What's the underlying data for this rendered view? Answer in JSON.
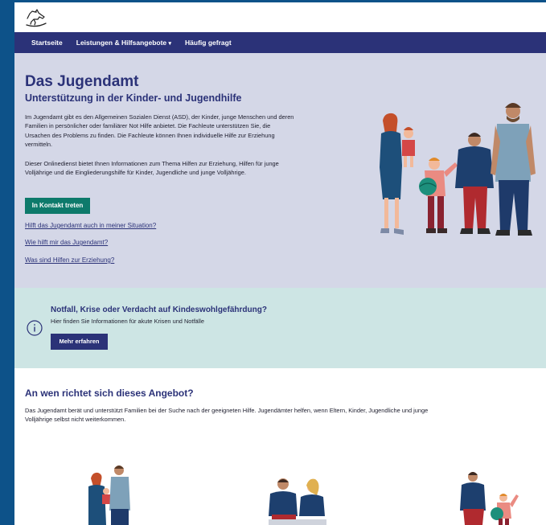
{
  "nav": {
    "items": [
      "Startseite",
      "Leistungen & Hilfsangebote",
      "Häufig gefragt"
    ]
  },
  "hero": {
    "title": "Das Jugendamt",
    "subtitle": "Unterstützung in der Kinder- und Jugendhilfe",
    "paragraph1": "Im Jugendamt gibt es den Allgemeinen Sozialen Dienst (ASD), der Kinder, junge Menschen und deren Familien in persönlicher oder familiärer Not Hilfe anbietet. Die Fachleute unterstützen Sie, die Ursachen des Problems zu finden. Die Fachleute können Ihnen individuelle Hilfe zur Erziehung vermitteln.",
    "paragraph2": "Dieser Onlinedienst bietet Ihnen Informationen zum Thema Hilfen zur Erziehung, Hilfen für junge Volljährige und die Eingliederungshilfe für Kinder, Jugendliche und junge Volljährige.",
    "contact_button": "In Kontakt treten",
    "links": [
      "Hilft das Jugendamt auch in meiner Situation?",
      "Wie hilft mir das Jugendamt?",
      "Was sind Hilfen zur Erziehung?"
    ]
  },
  "alert": {
    "title": "Notfall, Krise oder Verdacht auf Kindeswohlgefährdung?",
    "text": "Hier finden Sie Informationen für akute Krisen und Notfälle",
    "button": "Mehr erfahren"
  },
  "section": {
    "title": "An wen richtet sich dieses Angebot?",
    "text": "Das Jugendamt berät und unterstützt Familien bei der Suche nach der geeigneten Hilfe. Jugendämter helfen, wenn Eltern, Kinder, Jugendliche und junge Volljährige selbst nicht weiterkommen."
  },
  "icons": [
    "rocking-horse-logo",
    "chevron-down-icon",
    "info-icon"
  ],
  "colors": {
    "brand_navy": "#2b3278",
    "frame_blue": "#0d5289",
    "hero_bg": "#d4d7e7",
    "alert_bg": "#cde5e4",
    "button_green": "#0d7a6b"
  }
}
